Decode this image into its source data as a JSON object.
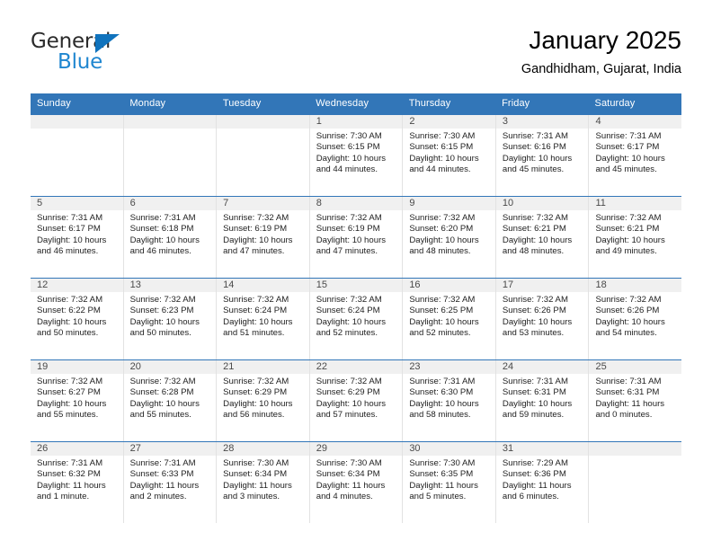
{
  "brand": {
    "word1": "General",
    "word2": "Blue",
    "triangle_color": "#1073bd",
    "blue_text_color": "#1f86d0"
  },
  "header": {
    "title": "January 2025",
    "location": "Gandhidham, Gujarat, India"
  },
  "theme": {
    "header_row_bg": "#3276b8",
    "header_row_text": "#ffffff",
    "daynum_bg": "#f0f0f0",
    "cell_border": "#e2e2e2",
    "week_divider": "#3276b8"
  },
  "weekday_headers": [
    "Sunday",
    "Monday",
    "Tuesday",
    "Wednesday",
    "Thursday",
    "Friday",
    "Saturday"
  ],
  "weeks": [
    [
      {
        "day": "",
        "sunrise": "",
        "sunset": "",
        "daylight_l1": "",
        "daylight_l2": ""
      },
      {
        "day": "",
        "sunrise": "",
        "sunset": "",
        "daylight_l1": "",
        "daylight_l2": ""
      },
      {
        "day": "",
        "sunrise": "",
        "sunset": "",
        "daylight_l1": "",
        "daylight_l2": ""
      },
      {
        "day": "1",
        "sunrise": "Sunrise: 7:30 AM",
        "sunset": "Sunset: 6:15 PM",
        "daylight_l1": "Daylight: 10 hours",
        "daylight_l2": "and 44 minutes."
      },
      {
        "day": "2",
        "sunrise": "Sunrise: 7:30 AM",
        "sunset": "Sunset: 6:15 PM",
        "daylight_l1": "Daylight: 10 hours",
        "daylight_l2": "and 44 minutes."
      },
      {
        "day": "3",
        "sunrise": "Sunrise: 7:31 AM",
        "sunset": "Sunset: 6:16 PM",
        "daylight_l1": "Daylight: 10 hours",
        "daylight_l2": "and 45 minutes."
      },
      {
        "day": "4",
        "sunrise": "Sunrise: 7:31 AM",
        "sunset": "Sunset: 6:17 PM",
        "daylight_l1": "Daylight: 10 hours",
        "daylight_l2": "and 45 minutes."
      }
    ],
    [
      {
        "day": "5",
        "sunrise": "Sunrise: 7:31 AM",
        "sunset": "Sunset: 6:17 PM",
        "daylight_l1": "Daylight: 10 hours",
        "daylight_l2": "and 46 minutes."
      },
      {
        "day": "6",
        "sunrise": "Sunrise: 7:31 AM",
        "sunset": "Sunset: 6:18 PM",
        "daylight_l1": "Daylight: 10 hours",
        "daylight_l2": "and 46 minutes."
      },
      {
        "day": "7",
        "sunrise": "Sunrise: 7:32 AM",
        "sunset": "Sunset: 6:19 PM",
        "daylight_l1": "Daylight: 10 hours",
        "daylight_l2": "and 47 minutes."
      },
      {
        "day": "8",
        "sunrise": "Sunrise: 7:32 AM",
        "sunset": "Sunset: 6:19 PM",
        "daylight_l1": "Daylight: 10 hours",
        "daylight_l2": "and 47 minutes."
      },
      {
        "day": "9",
        "sunrise": "Sunrise: 7:32 AM",
        "sunset": "Sunset: 6:20 PM",
        "daylight_l1": "Daylight: 10 hours",
        "daylight_l2": "and 48 minutes."
      },
      {
        "day": "10",
        "sunrise": "Sunrise: 7:32 AM",
        "sunset": "Sunset: 6:21 PM",
        "daylight_l1": "Daylight: 10 hours",
        "daylight_l2": "and 48 minutes."
      },
      {
        "day": "11",
        "sunrise": "Sunrise: 7:32 AM",
        "sunset": "Sunset: 6:21 PM",
        "daylight_l1": "Daylight: 10 hours",
        "daylight_l2": "and 49 minutes."
      }
    ],
    [
      {
        "day": "12",
        "sunrise": "Sunrise: 7:32 AM",
        "sunset": "Sunset: 6:22 PM",
        "daylight_l1": "Daylight: 10 hours",
        "daylight_l2": "and 50 minutes."
      },
      {
        "day": "13",
        "sunrise": "Sunrise: 7:32 AM",
        "sunset": "Sunset: 6:23 PM",
        "daylight_l1": "Daylight: 10 hours",
        "daylight_l2": "and 50 minutes."
      },
      {
        "day": "14",
        "sunrise": "Sunrise: 7:32 AM",
        "sunset": "Sunset: 6:24 PM",
        "daylight_l1": "Daylight: 10 hours",
        "daylight_l2": "and 51 minutes."
      },
      {
        "day": "15",
        "sunrise": "Sunrise: 7:32 AM",
        "sunset": "Sunset: 6:24 PM",
        "daylight_l1": "Daylight: 10 hours",
        "daylight_l2": "and 52 minutes."
      },
      {
        "day": "16",
        "sunrise": "Sunrise: 7:32 AM",
        "sunset": "Sunset: 6:25 PM",
        "daylight_l1": "Daylight: 10 hours",
        "daylight_l2": "and 52 minutes."
      },
      {
        "day": "17",
        "sunrise": "Sunrise: 7:32 AM",
        "sunset": "Sunset: 6:26 PM",
        "daylight_l1": "Daylight: 10 hours",
        "daylight_l2": "and 53 minutes."
      },
      {
        "day": "18",
        "sunrise": "Sunrise: 7:32 AM",
        "sunset": "Sunset: 6:26 PM",
        "daylight_l1": "Daylight: 10 hours",
        "daylight_l2": "and 54 minutes."
      }
    ],
    [
      {
        "day": "19",
        "sunrise": "Sunrise: 7:32 AM",
        "sunset": "Sunset: 6:27 PM",
        "daylight_l1": "Daylight: 10 hours",
        "daylight_l2": "and 55 minutes."
      },
      {
        "day": "20",
        "sunrise": "Sunrise: 7:32 AM",
        "sunset": "Sunset: 6:28 PM",
        "daylight_l1": "Daylight: 10 hours",
        "daylight_l2": "and 55 minutes."
      },
      {
        "day": "21",
        "sunrise": "Sunrise: 7:32 AM",
        "sunset": "Sunset: 6:29 PM",
        "daylight_l1": "Daylight: 10 hours",
        "daylight_l2": "and 56 minutes."
      },
      {
        "day": "22",
        "sunrise": "Sunrise: 7:32 AM",
        "sunset": "Sunset: 6:29 PM",
        "daylight_l1": "Daylight: 10 hours",
        "daylight_l2": "and 57 minutes."
      },
      {
        "day": "23",
        "sunrise": "Sunrise: 7:31 AM",
        "sunset": "Sunset: 6:30 PM",
        "daylight_l1": "Daylight: 10 hours",
        "daylight_l2": "and 58 minutes."
      },
      {
        "day": "24",
        "sunrise": "Sunrise: 7:31 AM",
        "sunset": "Sunset: 6:31 PM",
        "daylight_l1": "Daylight: 10 hours",
        "daylight_l2": "and 59 minutes."
      },
      {
        "day": "25",
        "sunrise": "Sunrise: 7:31 AM",
        "sunset": "Sunset: 6:31 PM",
        "daylight_l1": "Daylight: 11 hours",
        "daylight_l2": "and 0 minutes."
      }
    ],
    [
      {
        "day": "26",
        "sunrise": "Sunrise: 7:31 AM",
        "sunset": "Sunset: 6:32 PM",
        "daylight_l1": "Daylight: 11 hours",
        "daylight_l2": "and 1 minute."
      },
      {
        "day": "27",
        "sunrise": "Sunrise: 7:31 AM",
        "sunset": "Sunset: 6:33 PM",
        "daylight_l1": "Daylight: 11 hours",
        "daylight_l2": "and 2 minutes."
      },
      {
        "day": "28",
        "sunrise": "Sunrise: 7:30 AM",
        "sunset": "Sunset: 6:34 PM",
        "daylight_l1": "Daylight: 11 hours",
        "daylight_l2": "and 3 minutes."
      },
      {
        "day": "29",
        "sunrise": "Sunrise: 7:30 AM",
        "sunset": "Sunset: 6:34 PM",
        "daylight_l1": "Daylight: 11 hours",
        "daylight_l2": "and 4 minutes."
      },
      {
        "day": "30",
        "sunrise": "Sunrise: 7:30 AM",
        "sunset": "Sunset: 6:35 PM",
        "daylight_l1": "Daylight: 11 hours",
        "daylight_l2": "and 5 minutes."
      },
      {
        "day": "31",
        "sunrise": "Sunrise: 7:29 AM",
        "sunset": "Sunset: 6:36 PM",
        "daylight_l1": "Daylight: 11 hours",
        "daylight_l2": "and 6 minutes."
      },
      {
        "day": "",
        "sunrise": "",
        "sunset": "",
        "daylight_l1": "",
        "daylight_l2": ""
      }
    ]
  ]
}
